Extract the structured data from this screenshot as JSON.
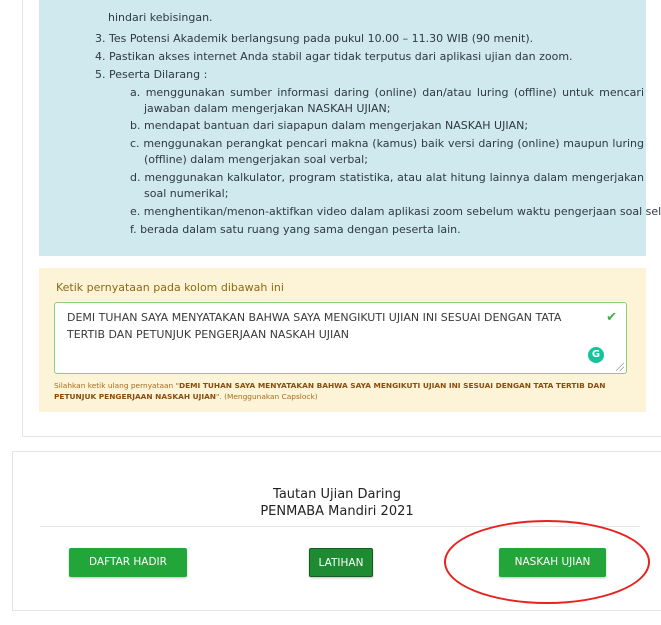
{
  "rules": {
    "line_top": "hindari kebisingan.",
    "item3": "3. Tes Potensi Akademik berlangsung pada pukul 10.00 – 11.30 WIB (90 menit).",
    "item4": "4. Pastikan akses internet Anda stabil agar tidak terputus dari aplikasi ujian dan zoom.",
    "item5": "5. Peserta Dilarang :",
    "sub": [
      "a. menggunakan sumber informasi daring (online) dan/atau luring (offline) untuk mencari jawaban dalam mengerjakan NASKAH UJIAN;",
      "b. mendapat bantuan dari siapapun dalam mengerjakan NASKAH UJIAN;",
      "c. menggunakan perangkat pencari makna (kamus) baik versi daring (online) maupun luring (offline) dalam mengerjakan soal verbal;",
      "d. menggunakan kalkulator, program statistika, atau alat hitung lainnya dalam mengerjakan soal numerikal;",
      "e. menghentikan/menon-aktifkan video dalam aplikasi zoom sebelum waktu pengerjaan soal selesai;",
      "f. berada dalam satu ruang yang sama dengan peserta lain."
    ]
  },
  "statement": {
    "label": "Ketik pernyataan pada kolom dibawah ini",
    "value": "DEMI TUHAN SAYA MENYATAKAN BAHWA SAYA MENGIKUTI UJIAN INI SESUAI DENGAN TATA TERTIB DAN PETUNJUK PENGERJAAN NASKAH UJIAN",
    "hint_prefix": "Silahkan ketik ulang pernyataan \"",
    "hint_bold": "DEMI TUHAN SAYA MENYATAKAN BAHWA SAYA MENGIKUTI UJIAN INI SESUAI DENGAN TATA TERTIB DAN PETUNJUK PENGERJAAN NASKAH UJIAN",
    "hint_suffix": "\". (Menggunakan Capslock)",
    "check_icon": "✔",
    "grammarly_icon": "G"
  },
  "links": {
    "title_line1": "Tautan Ujian Daring",
    "title_line2": "PENMABA Mandiri 2021",
    "btn_daftar": "DAFTAR HADIR",
    "btn_latihan": "LATIHAN",
    "btn_naskah": "NASKAH UJIAN"
  },
  "colors": {
    "info_bg": "#cfe9ef",
    "warn_bg": "#fdf4d7",
    "button_green": "#22a63a",
    "highlight_red": "#e8231f"
  }
}
